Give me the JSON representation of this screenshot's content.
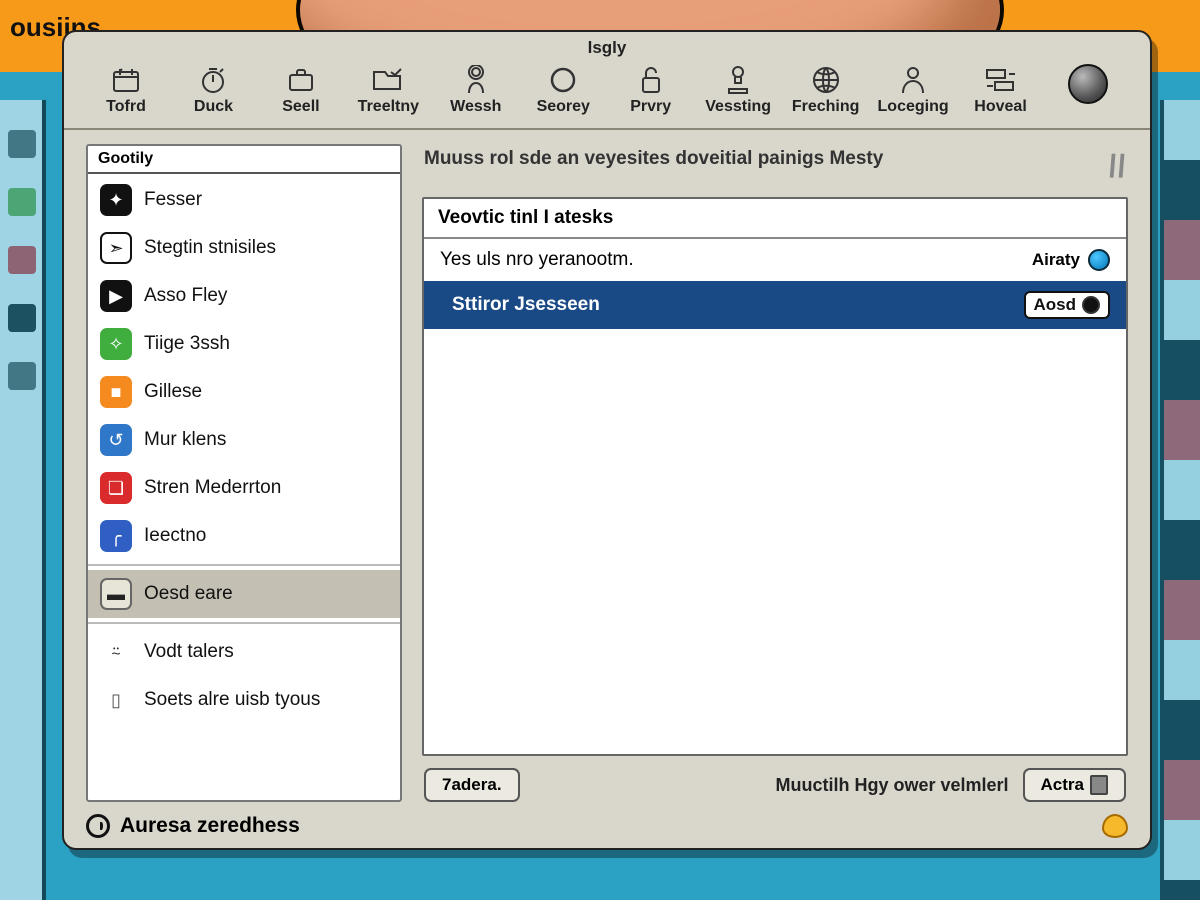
{
  "bg_tag": "ousiins",
  "window": {
    "title": "lsgly",
    "toolbar": [
      {
        "id": "tofrd",
        "label": "Tofrd",
        "icon": "calendar-icon"
      },
      {
        "id": "duck",
        "label": "Duck",
        "icon": "timer-icon"
      },
      {
        "id": "seell",
        "label": "Seell",
        "icon": "briefcase-icon"
      },
      {
        "id": "treeltny",
        "label": "Treeltny",
        "icon": "folder-check-icon"
      },
      {
        "id": "vessh",
        "label": "Wessh",
        "icon": "person-ring-icon"
      },
      {
        "id": "seorey",
        "label": "Seorey",
        "icon": "circle-icon"
      },
      {
        "id": "prvey",
        "label": "Prvry",
        "icon": "lock-icon"
      },
      {
        "id": "vesstng",
        "label": "Vessting",
        "icon": "stamp-icon"
      },
      {
        "id": "feelng",
        "label": "Freching",
        "icon": "globe-icon"
      },
      {
        "id": "looegng",
        "label": "Loceging",
        "icon": "person-icon"
      },
      {
        "id": "hoveal",
        "label": "Hoveal",
        "icon": "layout-icon"
      },
      {
        "id": "target",
        "label": "",
        "icon": "target-orb-icon"
      }
    ],
    "sidebar": {
      "header": "Gootily",
      "items": [
        {
          "label": "Fesser",
          "icon": "star-icon",
          "bg": "#111"
        },
        {
          "label": "Stegtin stnisiles",
          "icon": "compass-icon",
          "bg": "#fff",
          "fg": "#111",
          "border": "#111"
        },
        {
          "label": "Asso Fley",
          "icon": "play-icon",
          "bg": "#111"
        },
        {
          "label": "Tiige 3ssh",
          "icon": "nav-icon",
          "bg": "#3fae3f"
        },
        {
          "label": "Gillese",
          "icon": "square-icon",
          "bg": "#f58a1f"
        },
        {
          "label": "Mur klens",
          "icon": "swirl-icon",
          "bg": "#2f77c9"
        },
        {
          "label": "Stren Mederrton",
          "icon": "book-icon",
          "bg": "#d92b2b"
        },
        {
          "label": "Ieectno",
          "icon": "curve-icon",
          "bg": "#2f5fc2"
        },
        {
          "label": "Oesd eare",
          "icon": "chat-icon",
          "bg": "#e7e4d8",
          "fg": "#222",
          "border": "#666",
          "selected": true
        },
        {
          "label": "Vodt talers",
          "icon": "users-icon",
          "bg": "transparent",
          "fg": "#222"
        },
        {
          "label": "Soets alre uisb tyous",
          "icon": "doc-icon",
          "bg": "transparent",
          "fg": "#555"
        }
      ]
    },
    "main": {
      "description": "Muuss rol sde an veyesites doveitial painigs Mesty",
      "panel_header": "Veovtic tinl I atesks",
      "rows": [
        {
          "text": "Yes uls nro yeranootm.",
          "badge": "Airaty",
          "selected": false
        },
        {
          "text": "Sttiror Jsesseen",
          "badge": "Aosd",
          "selected": true
        }
      ],
      "footer_left_btn": "7adera.",
      "footer_right_text": "Muuctilh Hgy ower velmlerl",
      "footer_right_btn": "Actra"
    },
    "status": "Auresa zeredhess"
  }
}
